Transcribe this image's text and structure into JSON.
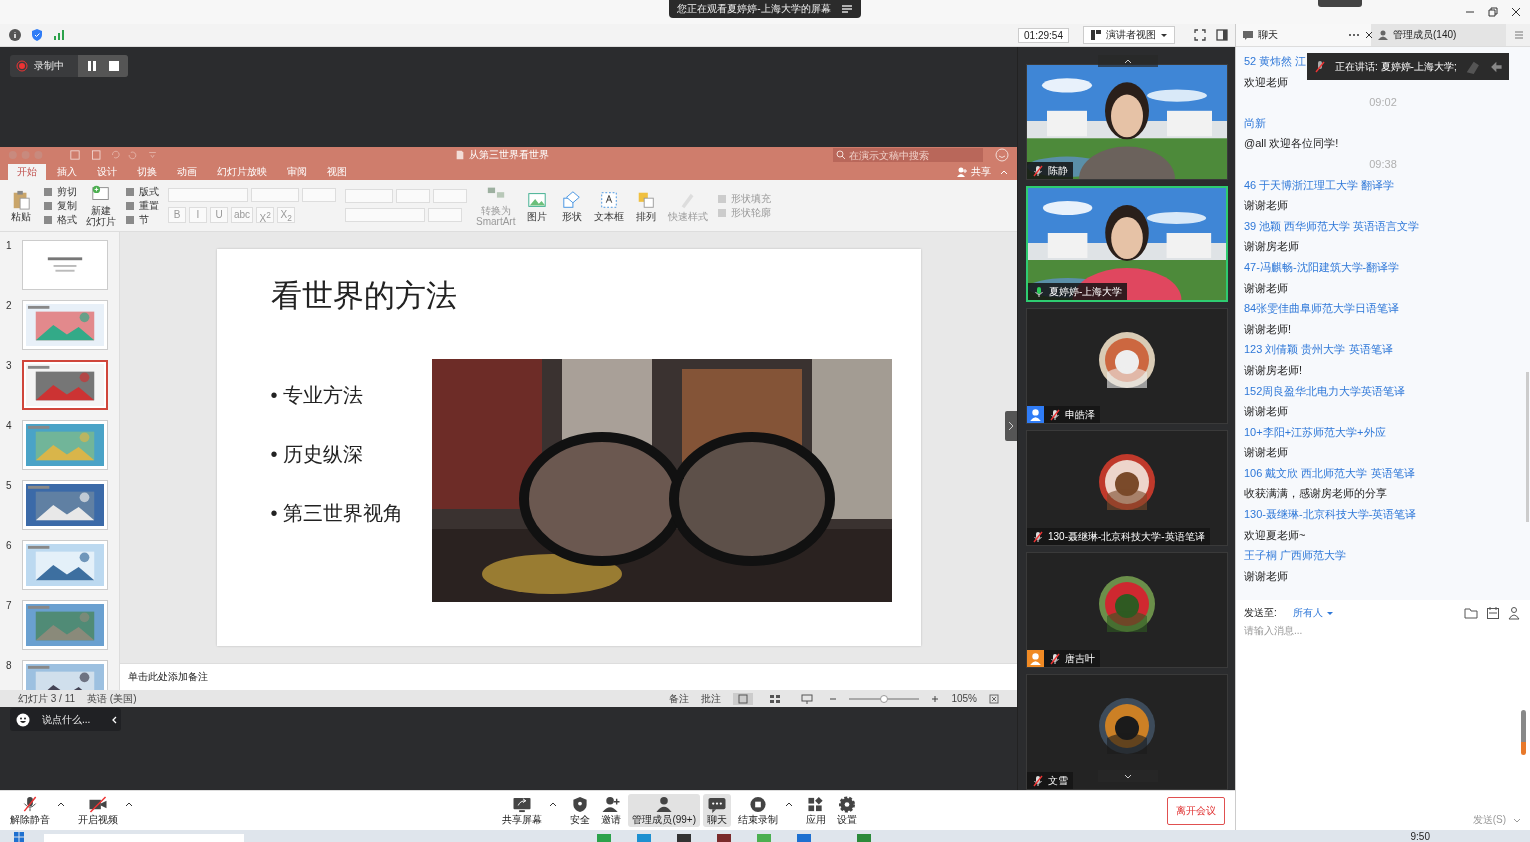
{
  "banner": {
    "text": "您正在观看夏婷婷-上海大学的屏幕"
  },
  "toolbar": {
    "timer": "01:29:54",
    "view_menu": "演讲者视图"
  },
  "recording": {
    "label": "录制中"
  },
  "ppt": {
    "title": "从第三世界看世界",
    "search_placeholder": "在演示文稿中搜索",
    "share": "共享",
    "tabs": [
      {
        "label": "开始",
        "selected": true
      },
      {
        "label": "插入",
        "selected": false
      },
      {
        "label": "设计",
        "selected": false
      },
      {
        "label": "切换",
        "selected": false
      },
      {
        "label": "动画",
        "selected": false
      },
      {
        "label": "幻灯片放映",
        "selected": false
      },
      {
        "label": "审阅",
        "selected": false
      },
      {
        "label": "视图",
        "selected": false
      }
    ],
    "ribbon": [
      {
        "kind": "large",
        "label": [
          "粘贴"
        ],
        "disabled": false
      },
      {
        "kind": "stack",
        "items": [
          {
            "label": "剪切",
            "disabled": false
          },
          {
            "label": "复制",
            "disabled": false
          },
          {
            "label": "格式",
            "disabled": false
          }
        ]
      },
      {
        "kind": "large",
        "label": [
          "新建",
          "幻灯片"
        ],
        "disabled": false
      },
      {
        "kind": "stack",
        "items": [
          {
            "label": "版式",
            "disabled": false
          },
          {
            "label": "重置",
            "disabled": false
          },
          {
            "label": "节",
            "disabled": false
          }
        ]
      },
      {
        "kind": "font",
        "items": [
          {
            "label": "B",
            "disabled": true
          },
          {
            "label": "I",
            "disabled": true
          },
          {
            "label": "U",
            "disabled": true
          },
          {
            "label": "abc",
            "disabled": true
          },
          {
            "label": "X$^{2}$",
            "disabled": true
          },
          {
            "label": "X$_{2}$",
            "disabled": true
          }
        ]
      },
      {
        "kind": "paragraph"
      },
      {
        "kind": "large",
        "label": [
          "转换为",
          "SmartArt"
        ],
        "disabled": true
      },
      {
        "kind": "large",
        "label": [
          "图片"
        ],
        "disabled": false
      },
      {
        "kind": "large",
        "label": [
          "形状"
        ],
        "disabled": false
      },
      {
        "kind": "large",
        "label": [
          "文本框"
        ],
        "disabled": false
      },
      {
        "kind": "large",
        "label": [
          "排列"
        ],
        "disabled": false
      },
      {
        "kind": "large",
        "label": [
          "快速样式"
        ],
        "disabled": true
      },
      {
        "kind": "stack",
        "items": [
          {
            "label": "形状填充",
            "disabled": true
          },
          {
            "label": "形状轮廓",
            "disabled": true
          }
        ]
      }
    ],
    "thumbnails": [
      {
        "number": "1",
        "kind": "text",
        "selected": false
      },
      {
        "number": "2",
        "kind": "picture",
        "selected": false
      },
      {
        "number": "3",
        "kind": "picture",
        "selected": true
      },
      {
        "number": "4",
        "kind": "picture",
        "selected": false
      },
      {
        "number": "5",
        "kind": "picture",
        "selected": false
      },
      {
        "number": "6",
        "kind": "picture",
        "selected": false
      },
      {
        "number": "7",
        "kind": "picture",
        "selected": false
      },
      {
        "number": "8",
        "kind": "picture",
        "selected": false
      }
    ],
    "slide": {
      "title": "看世界的方法",
      "bullet_marker": "•",
      "bullets": [
        "专业方法",
        "历史纵深",
        "第三世界视角"
      ]
    },
    "notes_placeholder": "单击此处添加备注",
    "status": {
      "slide": "幻灯片 3 / 11",
      "language": "英语 (美国)",
      "notes": "备注",
      "comments": "批注",
      "zoom": "105%",
      "level": 0.5
    }
  },
  "reaction": {
    "placeholder": "说点什么..."
  },
  "videos": [
    {
      "name": "陈静",
      "kind": "video",
      "muted": true,
      "speaking": false
    },
    {
      "name": "夏婷婷-上海大学",
      "kind": "video",
      "muted": false,
      "speaking": true
    },
    {
      "name": "申皓泽",
      "kind": "avatar",
      "muted": true,
      "speaking": false,
      "color": "#2f7cf6"
    },
    {
      "name": "130-聂继琳-北京科技大学-英语笔译",
      "kind": "avatar",
      "muted": true,
      "speaking": false
    },
    {
      "name": "唐吉叶",
      "kind": "avatar",
      "muted": true,
      "speaking": false,
      "color": "#f08a24"
    },
    {
      "name": "文雪",
      "kind": "avatar",
      "muted": true,
      "speaking": false
    }
  ],
  "chat": {
    "tabs": [
      {
        "label": "聊天",
        "selected": true
      },
      {
        "label": "管理成员(140)",
        "selected": false
      }
    ],
    "speaking": "正在讲话: 夏婷婷-上海大学;",
    "messages": [
      {
        "kind": "sender",
        "text": "52 黄炜然 江"
      },
      {
        "kind": "text",
        "text": "欢迎老师"
      },
      {
        "kind": "time",
        "text": "09:02"
      },
      {
        "kind": "sender",
        "text": "尚新"
      },
      {
        "kind": "text",
        "text": "@all 欢迎各位同学!"
      },
      {
        "kind": "time",
        "text": "09:38"
      },
      {
        "kind": "sender",
        "text": "46 于天博浙江理工大学 翻译学"
      },
      {
        "kind": "text",
        "text": "谢谢老师"
      },
      {
        "kind": "sender",
        "text": "39 池颖 西华师范大学 英语语言文学"
      },
      {
        "kind": "text",
        "text": "谢谢房老师"
      },
      {
        "kind": "sender",
        "text": "47-冯麒畅-沈阳建筑大学-翻译学"
      },
      {
        "kind": "text",
        "text": "谢谢老师"
      },
      {
        "kind": "sender",
        "text": "84张雯佳曲阜师范大学日语笔译"
      },
      {
        "kind": "text",
        "text": "谢谢老师!"
      },
      {
        "kind": "sender",
        "text": "123 刘倩颖 贵州大学 英语笔译"
      },
      {
        "kind": "text",
        "text": "谢谢房老师!"
      },
      {
        "kind": "sender",
        "text": "152周良盈华北电力大学英语笔译"
      },
      {
        "kind": "text",
        "text": "谢谢老师"
      },
      {
        "kind": "sender",
        "text": "10+李阳+江苏师范大学+外应"
      },
      {
        "kind": "text",
        "text": "谢谢老师"
      },
      {
        "kind": "sender",
        "text": "106 戴文欣 西北师范大学 英语笔译"
      },
      {
        "kind": "text",
        "text": "收获满满，感谢房老师的分享"
      },
      {
        "kind": "sender",
        "text": "130-聂继琳-北京科技大学-英语笔译"
      },
      {
        "kind": "text",
        "text": "欢迎夏老师~"
      },
      {
        "kind": "sender",
        "text": "王子桐 广西师范大学"
      },
      {
        "kind": "text",
        "text": "谢谢老师"
      }
    ],
    "send_to_label": "发送至:",
    "send_to": "所有人",
    "input_placeholder": "请输入消息...",
    "send": "发送(S)"
  },
  "bottom_bar": {
    "buttons": [
      {
        "kind": "mic",
        "label": "解除静音",
        "active": false,
        "caret": true
      },
      {
        "kind": "video",
        "label": "开启视频",
        "active": false,
        "caret": true
      },
      {
        "kind": "share",
        "label": "共享屏幕",
        "active": false,
        "caret": true
      },
      {
        "kind": "security",
        "label": "安全",
        "active": false,
        "caret": false
      },
      {
        "kind": "invite",
        "label": "邀请",
        "active": false,
        "caret": false
      },
      {
        "kind": "members",
        "label": "管理成员(99+)",
        "active": true,
        "caret": false
      },
      {
        "kind": "chat",
        "label": "聊天",
        "active": true,
        "caret": false
      },
      {
        "kind": "record",
        "label": "结束录制",
        "active": false,
        "caret": true
      },
      {
        "kind": "apps",
        "label": "应用",
        "active": false,
        "caret": false
      },
      {
        "kind": "settings",
        "label": "设置",
        "active": false,
        "caret": false
      }
    ],
    "leave": "离开会议"
  },
  "taskbar": {
    "time": "9:50"
  }
}
